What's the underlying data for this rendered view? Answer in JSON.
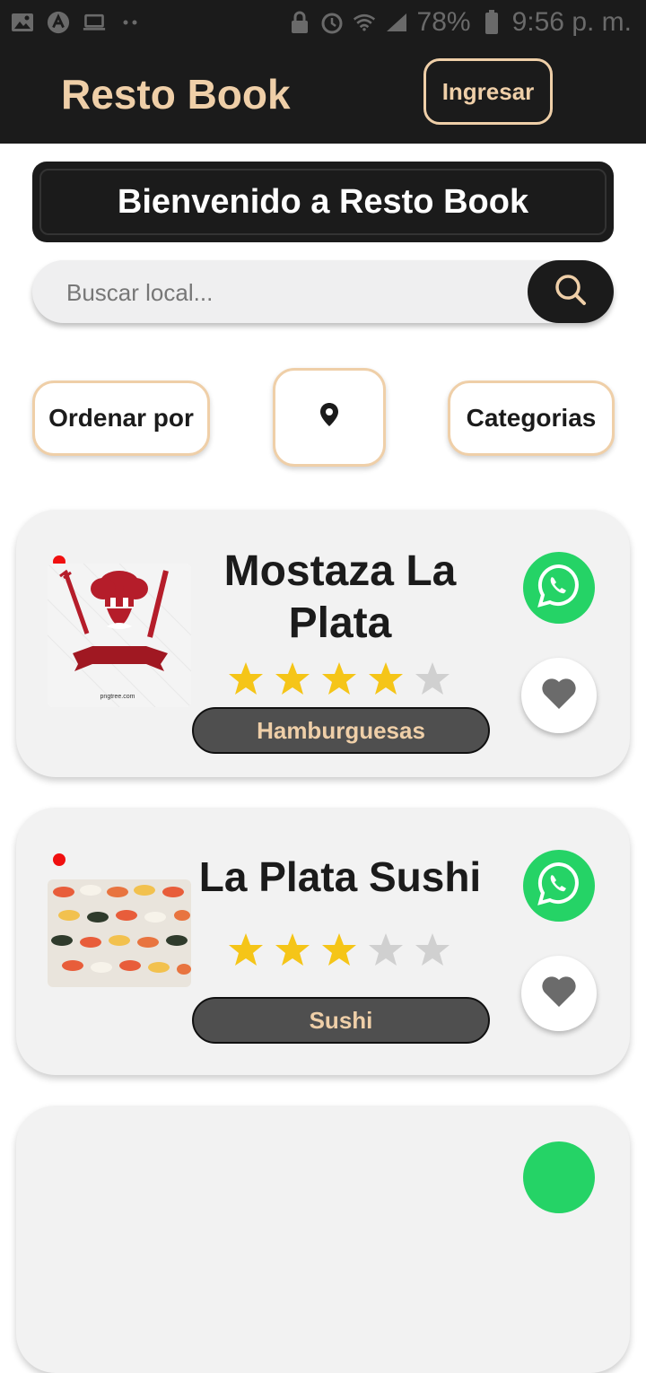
{
  "status_bar": {
    "battery": "78%",
    "time": "9:56 p. m.",
    "left_icons": [
      "image-icon",
      "app-icon",
      "laptop-icon",
      "more-dots-icon"
    ],
    "right_icons": [
      "lock-icon",
      "alarm-icon",
      "wifi-icon",
      "signal-icon",
      "battery-icon"
    ]
  },
  "header": {
    "title": "Resto Book",
    "login_label": "Ingresar"
  },
  "welcome": {
    "text": "Bienvenido a Resto Book"
  },
  "search": {
    "placeholder": "Buscar local...",
    "value": ""
  },
  "filters": {
    "sort_label": "Ordenar por",
    "location_icon": "location-pin-icon",
    "categories_label": "Categorias"
  },
  "restaurants": [
    {
      "name": "Mostaza La Plata",
      "rating": 4,
      "max_rating": 5,
      "category": "Hamburguesas",
      "image": "chef-logo"
    },
    {
      "name": "La Plata Sushi",
      "rating": 3,
      "max_rating": 5,
      "category": "Sushi",
      "image": "sushi-photo"
    }
  ],
  "colors": {
    "dark": "#1b1b1b",
    "accent": "#efcfa8",
    "star_filled": "#f5c518",
    "star_empty": "#d0d0d0",
    "whatsapp": "#25d366",
    "status_dot": "#f01010",
    "pill": "#4f4f4f"
  }
}
